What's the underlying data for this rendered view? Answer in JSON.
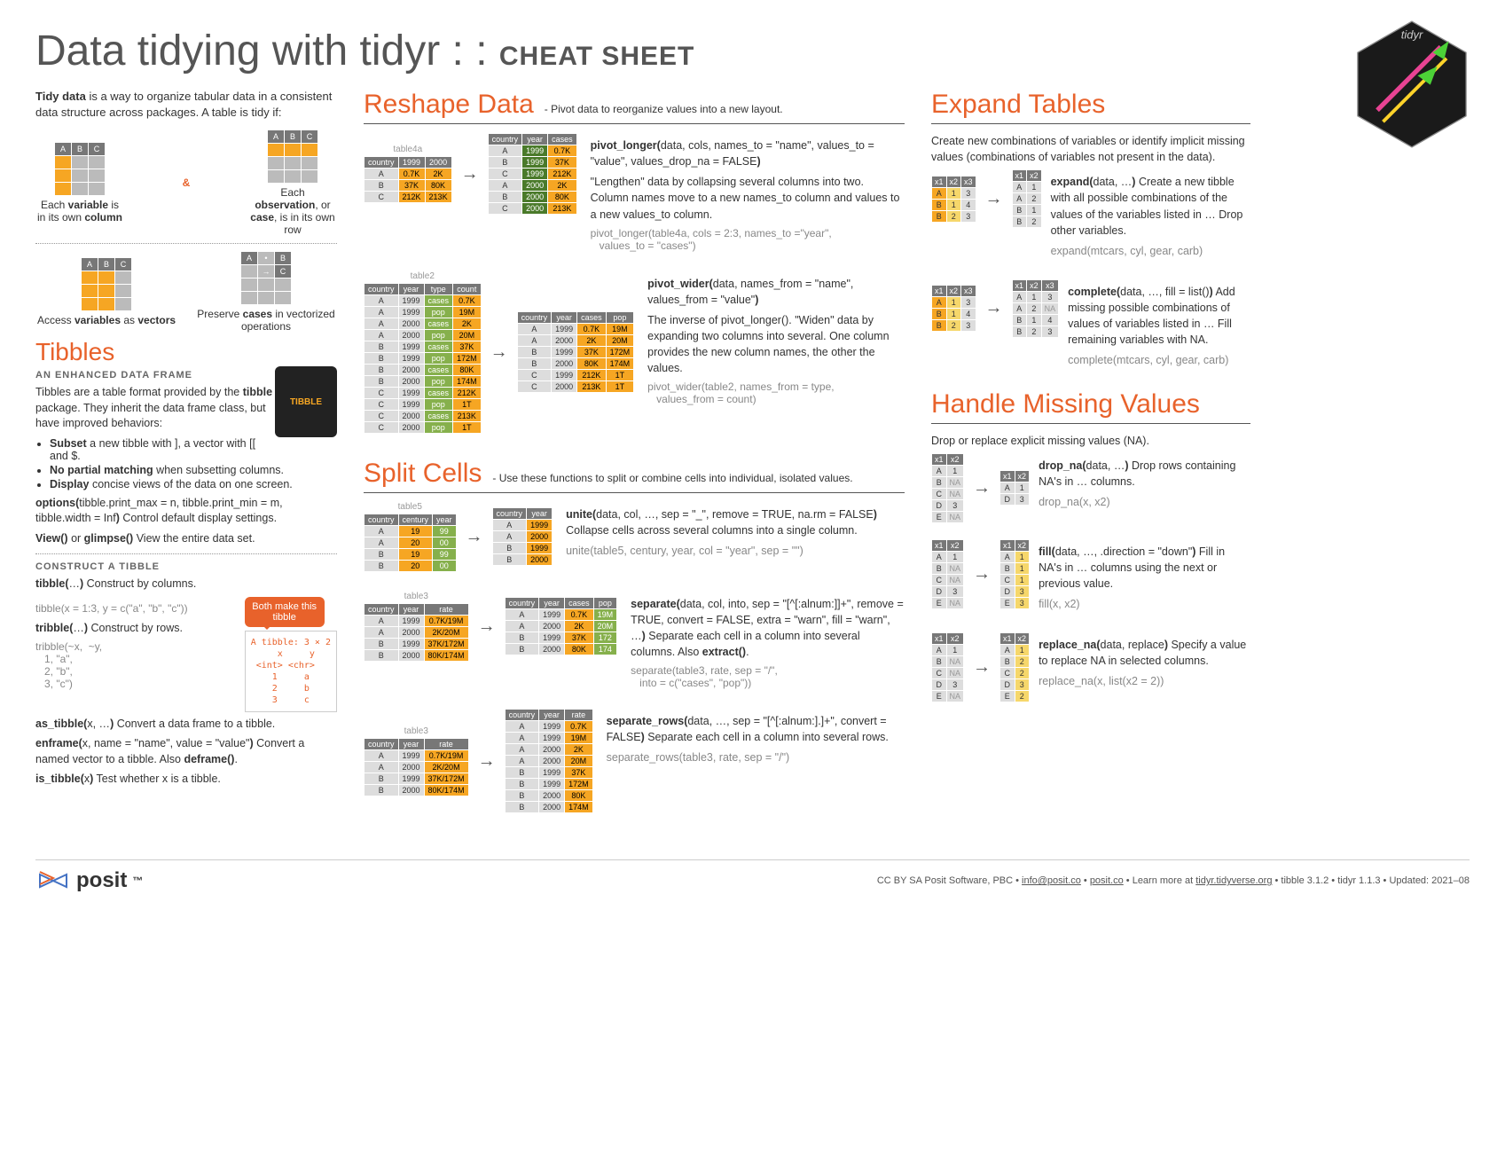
{
  "title_main": "Data tidying with tidyr : : ",
  "title_bold": "CHEAT SHEET",
  "intro": {
    "p1a": "Tidy data",
    "p1b": " is a way to organize tabular data in a consistent data structure across packages. A table is tidy if:",
    "rule1a": "Each ",
    "rule1b": "variable",
    "rule1c": " is in its own ",
    "rule1d": "column",
    "rule2a": "Each ",
    "rule2b": "observation",
    "rule2c": ", or ",
    "rule2d": "case",
    "rule2e": ", is in its own row",
    "rule3a": "Access ",
    "rule3b": "variables",
    "rule3c": " as ",
    "rule3d": "vectors",
    "rule4a": "Preserve ",
    "rule4b": "cases",
    "rule4c": " in vectorized operations"
  },
  "tibbles": {
    "h": "Tibbles",
    "sub": "AN ENHANCED DATA FRAME",
    "p1a": "Tibbles are a table format provided by the ",
    "p1b": "tibble",
    "p1c": " package. They inherit the data frame class, but have improved behaviors:",
    "li1a": "Subset",
    "li1b": " a new tibble with ], a vector with [[ and $.",
    "li2a": "No partial matching",
    "li2b": " when subsetting columns.",
    "li3a": "Display",
    "li3b": " concise views of the data on one screen.",
    "opt_a": "options(",
    "opt_b": "tibble.print_max = n, tibble.print_min = m, tibble.width = Inf",
    "opt_c": ")",
    "opt_d": " Control default display settings.",
    "view_a": "View()",
    "view_b": " or ",
    "view_c": "glimpse()",
    "view_d": " View the entire data set.",
    "construct_h": "CONSTRUCT A TIBBLE",
    "tibble_a": "tibble(",
    "tibble_b": "…",
    "tibble_c": ")",
    "tibble_d": " Construct by columns.",
    "tibble_ex": "tibble(x = 1:3, y = c(\"a\", \"b\", \"c\"))",
    "tribble_a": "tribble(",
    "tribble_b": "…",
    "tribble_c": ")",
    "tribble_d": " Construct by rows.",
    "tribble_ex": "tribble(~x,  ~y,\n   1, \"a\",\n   2, \"b\",\n   3, \"c\")",
    "callout": "Both make this tibble",
    "codebox": "A tibble: 3 × 2\n     x     y\n <int> <chr>\n    1     a\n    2     b\n    3     c",
    "astibble_a": "as_tibble(",
    "astibble_b": "x, …",
    "astibble_c": ")",
    "astibble_d": " Convert a data frame to a tibble.",
    "enframe_a": "enframe(",
    "enframe_b": "x, name = \"name\", value = \"value\"",
    "enframe_c": ")",
    "enframe_d": " Convert a named vector to a tibble. Also ",
    "enframe_e": "deframe()",
    "enframe_f": ".",
    "istibble_a": "is_tibble(",
    "istibble_b": "x",
    "istibble_c": ")",
    "istibble_d": " Test whether x is a tibble."
  },
  "reshape": {
    "h": "Reshape Data",
    "desc": "- Pivot data to reorganize values into a new layout.",
    "t4a_lbl": "table4a",
    "t4a": {
      "h": [
        "country",
        "1999",
        "2000"
      ],
      "r": [
        [
          "A",
          "0.7K",
          "2K"
        ],
        [
          "B",
          "37K",
          "80K"
        ],
        [
          "C",
          "212K",
          "213K"
        ]
      ]
    },
    "t4a_out": {
      "h": [
        "country",
        "year",
        "cases"
      ],
      "r": [
        [
          "A",
          "1999",
          "0.7K"
        ],
        [
          "B",
          "1999",
          "37K"
        ],
        [
          "C",
          "1999",
          "212K"
        ],
        [
          "A",
          "2000",
          "2K"
        ],
        [
          "B",
          "2000",
          "80K"
        ],
        [
          "C",
          "2000",
          "213K"
        ]
      ]
    },
    "pl_a": "pivot_longer(",
    "pl_b": "data, cols, names_to = \"name\", values_to = \"value\", values_drop_na = FALSE",
    "pl_c": ")",
    "pl_d": "\"Lengthen\" data by collapsing several columns into two. Column names move to a new names_to column and values to a new values_to column.",
    "pl_ex": "pivot_longer(table4a, cols = 2:3, names_to =\"year\",\n   values_to = \"cases\")",
    "t2_lbl": "table2",
    "t2": {
      "h": [
        "country",
        "year",
        "type",
        "count"
      ],
      "r": [
        [
          "A",
          "1999",
          "cases",
          "0.7K"
        ],
        [
          "A",
          "1999",
          "pop",
          "19M"
        ],
        [
          "A",
          "2000",
          "cases",
          "2K"
        ],
        [
          "A",
          "2000",
          "pop",
          "20M"
        ],
        [
          "B",
          "1999",
          "cases",
          "37K"
        ],
        [
          "B",
          "1999",
          "pop",
          "172M"
        ],
        [
          "B",
          "2000",
          "cases",
          "80K"
        ],
        [
          "B",
          "2000",
          "pop",
          "174M"
        ],
        [
          "C",
          "1999",
          "cases",
          "212K"
        ],
        [
          "C",
          "1999",
          "pop",
          "1T"
        ],
        [
          "C",
          "2000",
          "cases",
          "213K"
        ],
        [
          "C",
          "2000",
          "pop",
          "1T"
        ]
      ]
    },
    "t2_out": {
      "h": [
        "country",
        "year",
        "cases",
        "pop"
      ],
      "r": [
        [
          "A",
          "1999",
          "0.7K",
          "19M"
        ],
        [
          "A",
          "2000",
          "2K",
          "20M"
        ],
        [
          "B",
          "1999",
          "37K",
          "172M"
        ],
        [
          "B",
          "2000",
          "80K",
          "174M"
        ],
        [
          "C",
          "1999",
          "212K",
          "1T"
        ],
        [
          "C",
          "2000",
          "213K",
          "1T"
        ]
      ]
    },
    "pw_a": "pivot_wider(",
    "pw_b": "data, names_from = \"name\", values_from = \"value\"",
    "pw_c": ")",
    "pw_d": "The inverse of pivot_longer(). \"Widen\" data by expanding two columns into several. One column provides the new column names, the other the values.",
    "pw_ex": "pivot_wider(table2, names_from = type,\n   values_from = count)"
  },
  "split": {
    "h": "Split Cells",
    "desc": "- Use these functions to split or combine cells into individual, isolated values.",
    "t5_lbl": "table5",
    "t5": {
      "h": [
        "country",
        "century",
        "year"
      ],
      "r": [
        [
          "A",
          "19",
          "99"
        ],
        [
          "A",
          "20",
          "00"
        ],
        [
          "B",
          "19",
          "99"
        ],
        [
          "B",
          "20",
          "00"
        ]
      ]
    },
    "t5_out": {
      "h": [
        "country",
        "year"
      ],
      "r": [
        [
          "A",
          "1999"
        ],
        [
          "A",
          "2000"
        ],
        [
          "B",
          "1999"
        ],
        [
          "B",
          "2000"
        ]
      ]
    },
    "un_a": "unite(",
    "un_b": "data, col, …, sep = \"_\", remove = TRUE, na.rm = FALSE",
    "un_c": ")",
    "un_d": " Collapse cells across several columns into a single column.",
    "un_ex": "unite(table5, century, year, col = \"year\", sep = \"\")",
    "t3_lbl": "table3",
    "t3": {
      "h": [
        "country",
        "year",
        "rate"
      ],
      "r": [
        [
          "A",
          "1999",
          "0.7K/19M"
        ],
        [
          "A",
          "2000",
          "2K/20M"
        ],
        [
          "B",
          "1999",
          "37K/172M"
        ],
        [
          "B",
          "2000",
          "80K/174M"
        ]
      ]
    },
    "t3_out": {
      "h": [
        "country",
        "year",
        "cases",
        "pop"
      ],
      "r": [
        [
          "A",
          "1999",
          "0.7K",
          "19M"
        ],
        [
          "A",
          "2000",
          "2K",
          "20M"
        ],
        [
          "B",
          "1999",
          "37K",
          "172"
        ],
        [
          "B",
          "2000",
          "80K",
          "174"
        ]
      ]
    },
    "sep_a": "separate(",
    "sep_b": "data, col, into, sep = \"[^[:alnum:]]+\", remove = TRUE, convert = FALSE, extra = \"warn\", fill = \"warn\", …",
    "sep_c": ")",
    "sep_d": " Separate each cell in a column into several columns. Also ",
    "sep_e": "extract()",
    "sep_f": ".",
    "sep_ex": "separate(table3, rate, sep = \"/\",\n   into = c(\"cases\", \"pop\"))",
    "t3b_out": {
      "h": [
        "country",
        "year",
        "rate"
      ],
      "r": [
        [
          "A",
          "1999",
          "0.7K"
        ],
        [
          "A",
          "1999",
          "19M"
        ],
        [
          "A",
          "2000",
          "2K"
        ],
        [
          "A",
          "2000",
          "20M"
        ],
        [
          "B",
          "1999",
          "37K"
        ],
        [
          "B",
          "1999",
          "172M"
        ],
        [
          "B",
          "2000",
          "80K"
        ],
        [
          "B",
          "2000",
          "174M"
        ]
      ]
    },
    "sr_a": "separate_rows(",
    "sr_b": "data, …, sep = \"[^[:alnum:].]+\", convert = FALSE",
    "sr_c": ")",
    "sr_d": " Separate each cell in a column into several rows.",
    "sr_ex": "separate_rows(table3, rate, sep = \"/\")"
  },
  "expand": {
    "h": "Expand Tables",
    "desc": "Create new combinations of variables or identify implicit missing values (combinations of variables not present in the data).",
    "ex_in": {
      "h": [
        "x1",
        "x2",
        "x3"
      ],
      "r": [
        [
          "A",
          "1",
          "3"
        ],
        [
          "B",
          "1",
          "4"
        ],
        [
          "B",
          "2",
          "3"
        ]
      ]
    },
    "ex_out": {
      "h": [
        "x1",
        "x2"
      ],
      "r": [
        [
          "A",
          "1"
        ],
        [
          "A",
          "2"
        ],
        [
          "B",
          "1"
        ],
        [
          "B",
          "2"
        ]
      ]
    },
    "ex_a": "expand(",
    "ex_b": "data, …",
    "ex_c": ")",
    "ex_d": " Create a new tibble with all possible combinations of the values of the variables listed in … Drop other variables.",
    "ex_ex": "expand(mtcars, cyl, gear, carb)",
    "cp_out": {
      "h": [
        "x1",
        "x2",
        "x3"
      ],
      "r": [
        [
          "A",
          "1",
          "3"
        ],
        [
          "A",
          "2",
          "NA"
        ],
        [
          "B",
          "1",
          "4"
        ],
        [
          "B",
          "2",
          "3"
        ]
      ]
    },
    "cp_a": "complete(",
    "cp_b": "data, …, fill = list()",
    "cp_c": ")",
    "cp_d": " Add missing possible combinations of values of variables listed in … Fill remaining variables with NA.",
    "cp_ex": "complete(mtcars, cyl, gear, carb)"
  },
  "missing": {
    "h": "Handle Missing Values",
    "desc": "Drop or replace explicit missing values (NA).",
    "dn_in": {
      "h": [
        "x1",
        "x2"
      ],
      "r": [
        [
          "A",
          "1"
        ],
        [
          "B",
          "NA"
        ],
        [
          "C",
          "NA"
        ],
        [
          "D",
          "3"
        ],
        [
          "E",
          "NA"
        ]
      ]
    },
    "dn_out": {
      "h": [
        "x1",
        "x2"
      ],
      "r": [
        [
          "A",
          "1"
        ],
        [
          "D",
          "3"
        ]
      ]
    },
    "dn_a": "drop_na(",
    "dn_b": "data, …",
    "dn_c": ")",
    "dn_d": " Drop rows containing NA's in … columns.",
    "dn_ex": "drop_na(x, x2)",
    "fl_in": {
      "h": [
        "x1",
        "x2"
      ],
      "r": [
        [
          "A",
          "1"
        ],
        [
          "B",
          "NA"
        ],
        [
          "C",
          "NA"
        ],
        [
          "D",
          "3"
        ],
        [
          "E",
          "NA"
        ]
      ]
    },
    "fl_out": {
      "h": [
        "x1",
        "x2"
      ],
      "r": [
        [
          "A",
          "1"
        ],
        [
          "B",
          "1"
        ],
        [
          "C",
          "1"
        ],
        [
          "D",
          "3"
        ],
        [
          "E",
          "3"
        ]
      ]
    },
    "fl_a": "fill(",
    "fl_b": "data, …, .direction = \"down\"",
    "fl_c": ")",
    "fl_d": " Fill in NA's in … columns using the next or previous value.",
    "fl_ex": "fill(x, x2)",
    "rn_in": {
      "h": [
        "x1",
        "x2"
      ],
      "r": [
        [
          "A",
          "1"
        ],
        [
          "B",
          "NA"
        ],
        [
          "C",
          "NA"
        ],
        [
          "D",
          "3"
        ],
        [
          "E",
          "NA"
        ]
      ]
    },
    "rn_out": {
      "h": [
        "x1",
        "x2"
      ],
      "r": [
        [
          "A",
          "1"
        ],
        [
          "B",
          "2"
        ],
        [
          "C",
          "2"
        ],
        [
          "D",
          "3"
        ],
        [
          "E",
          "2"
        ]
      ]
    },
    "rn_a": "replace_na(",
    "rn_b": "data, replace",
    "rn_c": ")",
    "rn_d": " Specify a value to replace NA in selected columns.",
    "rn_ex": "replace_na(x, list(x2 = 2))"
  },
  "footer": {
    "logo": "posit",
    "text_a": "CC BY SA Posit Software, PBC • ",
    "link1": "info@posit.co",
    "sep1": " • ",
    "link2": "posit.co",
    "text_b": " • Learn more at ",
    "link3": "tidyr.tidyverse.org",
    "text_c": " • tibble  3.1.2  • tidyr  1.1.3  • Updated:  2021–08"
  }
}
